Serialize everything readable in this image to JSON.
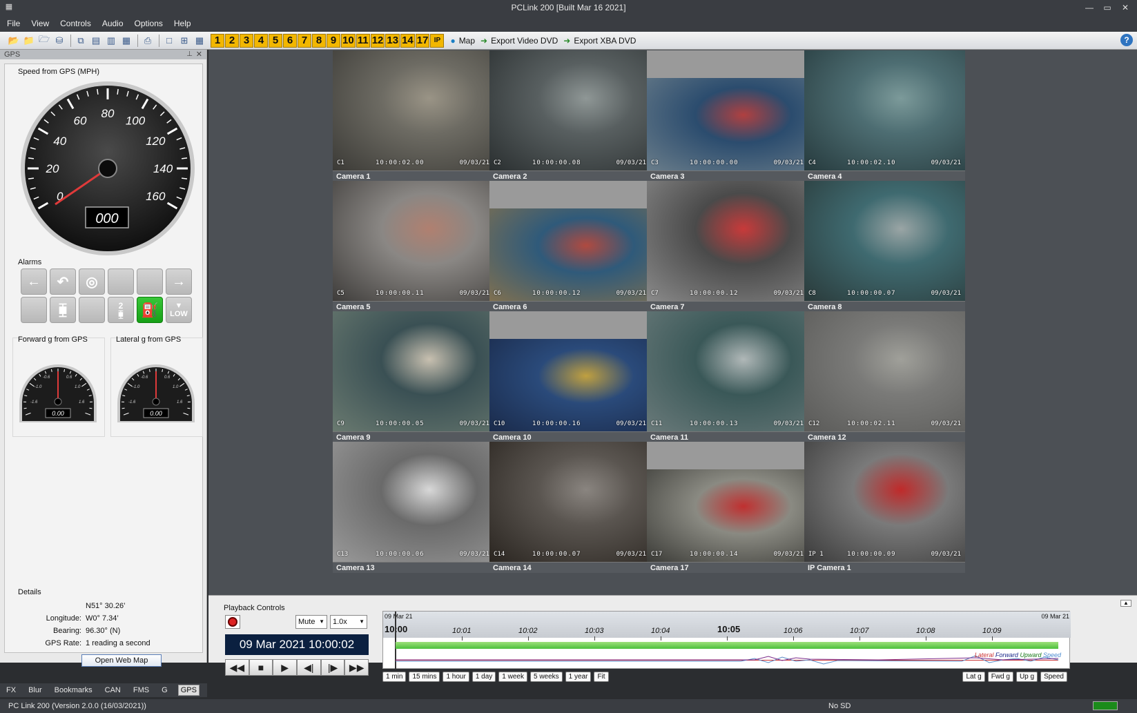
{
  "window": {
    "title": "PCLink 200 [Built Mar 16 2021]"
  },
  "menu": [
    "File",
    "View",
    "Controls",
    "Audio",
    "Options",
    "Help"
  ],
  "toolbar": {
    "numbers": [
      "1",
      "2",
      "3",
      "4",
      "5",
      "6",
      "7",
      "8",
      "9",
      "10",
      "11",
      "12",
      "13",
      "14",
      "17",
      "IP"
    ],
    "map_label": "Map",
    "export_video_label": "Export Video DVD",
    "export_xba_label": "Export XBA DVD"
  },
  "gps_panel": {
    "header": "GPS",
    "speed_label": "Speed from GPS (MPH)",
    "speed_ticks": [
      "0",
      "20",
      "40",
      "60",
      "80",
      "100",
      "120",
      "140",
      "160"
    ],
    "speed_value": "000",
    "alarms_label": "Alarms",
    "alarm_low_label": "LOW",
    "alarm_2_label": "2",
    "forward_g_label": "Forward g from GPS",
    "lateral_g_label": "Lateral g from GPS",
    "g_ticks": [
      "-1.6",
      "-1.0",
      "-0.6",
      "0.6",
      "1.0",
      "1.6"
    ],
    "forward_g_value": "0.00",
    "lateral_g_value": "0.00",
    "details_label": "Details",
    "latitude": "N51° 30.26’",
    "longitude_key": "Longitude:",
    "longitude": "W0° 7.34’",
    "bearing_key": "Bearing:",
    "bearing": "96.30° (N)",
    "gps_rate_key": "GPS Rate:",
    "gps_rate": "1 reading a second",
    "open_web_map": "Open Web Map"
  },
  "bottom_tabs": [
    "FX",
    "Blur",
    "Bookmarks",
    "CAN",
    "FMS",
    "G",
    "GPS"
  ],
  "cameras": [
    {
      "label": "Camera 1",
      "cid": "C1",
      "time": "10:00:02.00",
      "date": "09/03/21"
    },
    {
      "label": "Camera 2",
      "cid": "C2",
      "time": "10:00:00.08",
      "date": "09/03/21"
    },
    {
      "label": "Camera 3",
      "cid": "C3",
      "time": "10:00:00.00",
      "date": "09/03/21"
    },
    {
      "label": "Camera 4",
      "cid": "C4",
      "time": "10:00:02.10",
      "date": "09/03/21"
    },
    {
      "label": "Camera 5",
      "cid": "C5",
      "time": "10:00:00.11",
      "date": "09/03/21"
    },
    {
      "label": "Camera 6",
      "cid": "C6",
      "time": "10:00:00.12",
      "date": "09/03/21"
    },
    {
      "label": "Camera 7",
      "cid": "C7",
      "time": "10:00:00.12",
      "date": "09/03/21"
    },
    {
      "label": "Camera 8",
      "cid": "C8",
      "time": "10:00:00.07",
      "date": "09/03/21"
    },
    {
      "label": "Camera 9",
      "cid": "C9",
      "time": "10:00:00.05",
      "date": "09/03/21"
    },
    {
      "label": "Camera 10",
      "cid": "C10",
      "time": "10:00:00.16",
      "date": "09/03/21"
    },
    {
      "label": "Camera 11",
      "cid": "C11",
      "time": "10:00:00.13",
      "date": "09/03/21"
    },
    {
      "label": "Camera 12",
      "cid": "C12",
      "time": "10:00:02.11",
      "date": "09/03/21"
    },
    {
      "label": "Camera 13",
      "cid": "C13",
      "time": "10:00:00.06",
      "date": "09/03/21"
    },
    {
      "label": "Camera 14",
      "cid": "C14",
      "time": "10:00:00.07",
      "date": "09/03/21"
    },
    {
      "label": "Camera 17",
      "cid": "C17",
      "time": "10:00:00.14",
      "date": "09/03/21"
    },
    {
      "label": "IP Camera 1",
      "cid": "IP 1",
      "time": "10:00:00.09",
      "date": "09/03/21"
    }
  ],
  "playback": {
    "title": "Playback Controls",
    "mute": "Mute",
    "speed": "1.0x",
    "clock": "09 Mar 2021  10:00:02",
    "timeline_start_date": "09 Mar 21",
    "timeline_end_date": "09 Mar 21",
    "ticks": [
      "10:00",
      "10:01",
      "10:02",
      "10:03",
      "10:04",
      "10:05",
      "10:06",
      "10:07",
      "10:08",
      "10:09"
    ],
    "legend": [
      "Lateral",
      "Forward",
      "Upward",
      "Speed"
    ],
    "ranges": [
      "1 min",
      "15 mins",
      "1 hour",
      "1 day",
      "1 week",
      "5 weeks",
      "1 year",
      "Fit"
    ],
    "graphs": [
      "Lat g",
      "Fwd g",
      "Up g",
      "Speed"
    ]
  },
  "status": {
    "version": "PC Link 200 (Version 2.0.0 (16/03/2021))",
    "sd": "No SD"
  },
  "colors": {
    "accent_orange": "#f2b700",
    "panel": "#e9e9e9",
    "dark": "#3a3d42"
  }
}
